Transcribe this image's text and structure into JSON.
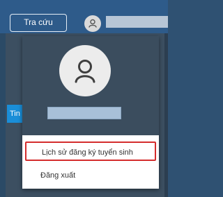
{
  "header": {
    "search_button_label": "Tra cứu"
  },
  "side_tab": {
    "label": "Tin"
  },
  "user_menu": {
    "items": [
      {
        "label": "Lịch sử đăng ký tuyển sinh"
      },
      {
        "label": "Đăng xuất"
      }
    ]
  },
  "colors": {
    "header_bg": "#2e5b8a",
    "menu_header_bg": "#3b4d5e",
    "highlight_border": "#d42c2c",
    "tab_bg": "#1a8ed8"
  },
  "icons": {
    "small_avatar": "user-icon",
    "large_avatar": "user-icon"
  }
}
